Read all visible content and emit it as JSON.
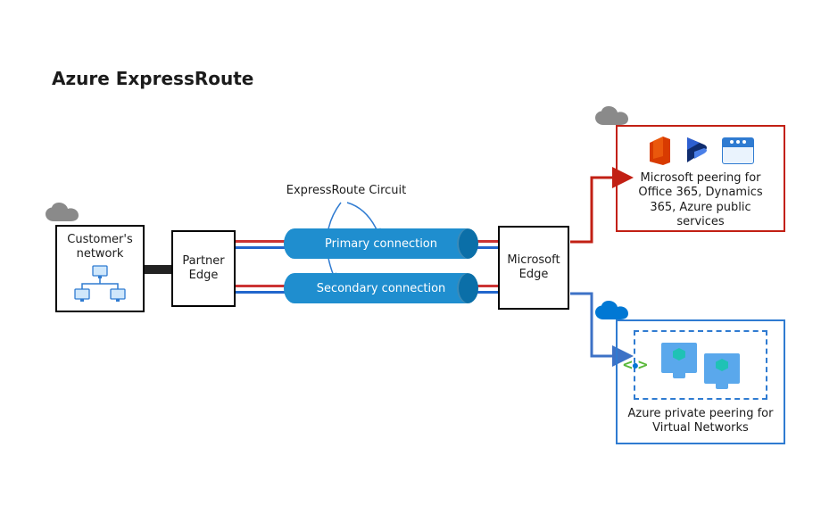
{
  "title": "Azure ExpressRoute",
  "customer_box": {
    "label": "Customer's network"
  },
  "partner_box": {
    "label": "Partner Edge"
  },
  "circuit_label": "ExpressRoute Circuit",
  "conn": {
    "primary": "Primary connection",
    "secondary": "Secondary connection"
  },
  "msedge_box": {
    "label": "Microsoft Edge"
  },
  "ms_peering": {
    "text": "Microsoft peering for Office 365, Dynamics 365, Azure public services",
    "products": [
      "Office 365",
      "Dynamics 365",
      "Azure public services"
    ]
  },
  "private_peering": {
    "text": "Azure private peering for Virtual Networks"
  },
  "icons": {
    "cloud_gray": "cloud-icon",
    "cloud_blue": "cloud-icon",
    "office": "office-365-icon",
    "dynamics": "dynamics-365-icon",
    "browser": "browser-icon",
    "peering": "peering-icon",
    "vm": "virtual-machine-icon",
    "lan": "lan-icon"
  },
  "colors": {
    "blue": "#1f8ecf",
    "darkblue": "#0b6fa8",
    "red": "#c22014",
    "azure": "#0078d4",
    "wire_red": "#cc3333",
    "wire_blue": "#2266cc"
  }
}
